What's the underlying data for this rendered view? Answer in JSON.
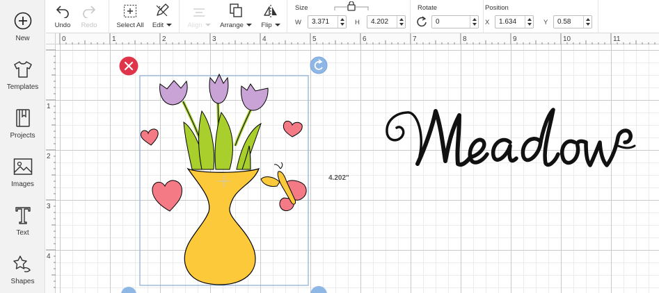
{
  "sidebar": {
    "new_label": "New",
    "items": [
      {
        "label": "Templates",
        "icon": "tshirt-icon"
      },
      {
        "label": "Projects",
        "icon": "book-icon"
      },
      {
        "label": "Images",
        "icon": "image-icon"
      },
      {
        "label": "Text",
        "icon": "text-icon"
      },
      {
        "label": "Shapes",
        "icon": "shapes-icon"
      }
    ]
  },
  "toolbar": {
    "undo_label": "Undo",
    "redo_label": "Redo",
    "select_all_label": "Select All",
    "edit_label": "Edit",
    "align_label": "Align",
    "arrange_label": "Arrange",
    "flip_label": "Flip",
    "size": {
      "title": "Size",
      "w_label": "W",
      "w_value": "3.371",
      "h_label": "H",
      "h_value": "4.202"
    },
    "rotate": {
      "title": "Rotate",
      "value": "0"
    },
    "position": {
      "title": "Position",
      "x_label": "X",
      "x_value": "1.634",
      "y_label": "Y",
      "y_value": "0.58"
    }
  },
  "ruler": {
    "top_ticks": [
      "0",
      "1",
      "2",
      "3",
      "4",
      "5",
      "6",
      "7",
      "8",
      "9",
      "10",
      "11"
    ],
    "left_ticks": [
      "1",
      "2",
      "3",
      "4"
    ]
  },
  "canvas": {
    "height_readout": "4.202\"",
    "text_object": "Meadow"
  },
  "colors": {
    "delete_handle": "#e0344a",
    "handle_blue": "#8fb7e6",
    "vase": "#fcc93a",
    "tulip": "#c9a3d6",
    "leaf": "#a8cf2b",
    "heart": "#f47a86",
    "butterfly_wing": "#f47a86",
    "butterfly_body": "#fcc93a"
  }
}
